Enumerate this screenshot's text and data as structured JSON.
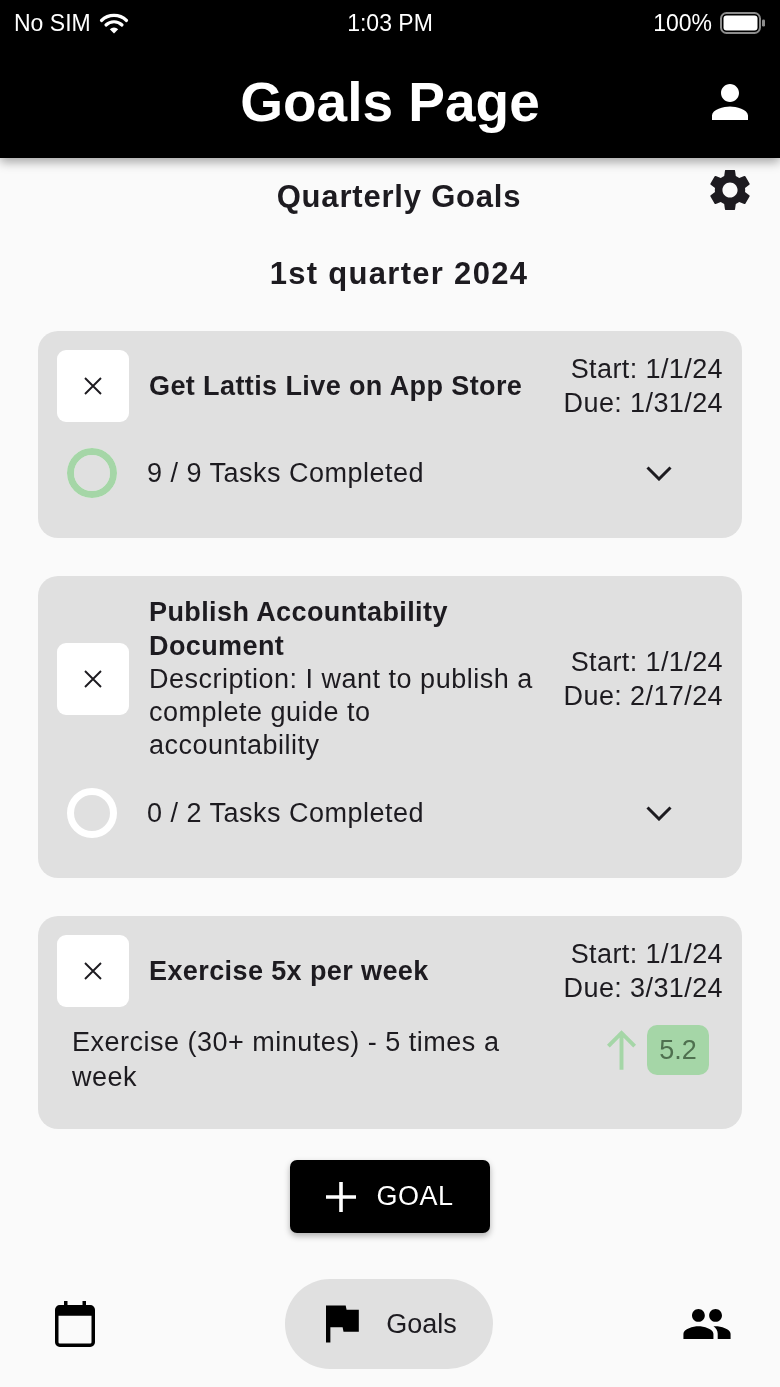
{
  "status_bar": {
    "carrier": "No SIM",
    "time": "1:03 PM",
    "battery": "100%"
  },
  "app_bar": {
    "title": "Goals Page"
  },
  "header": {
    "title": "Quarterly Goals",
    "period": "1st quarter 2024"
  },
  "goals": [
    {
      "kind": "tasks",
      "title": "Get Lattis Live on App Store",
      "start": "Start: 1/1/24",
      "due": "Due: 1/31/24",
      "progress": {
        "label": "9 / 9 Tasks Completed",
        "level": 1
      }
    },
    {
      "kind": "tasks",
      "title": "Publish Accountability Document",
      "description": "Description: I want to publish a complete guide to accountability",
      "start": "Start: 1/1/24",
      "due": "Due: 2/17/24",
      "progress": {
        "label": "0 / 2 Tasks Completed",
        "level": 0
      }
    },
    {
      "kind": "metric",
      "title": "Exercise 5x per week",
      "start": "Start: 1/1/24",
      "due": "Due: 3/31/24",
      "description": "Exercise (30+ minutes) - 5 times a week",
      "improving": true,
      "value": "5.2"
    }
  ],
  "add_button": {
    "label": "GOAL"
  },
  "bottom_nav": [
    {
      "kind": "calendar",
      "selected": false
    },
    {
      "kind": "flag",
      "label": "Goals",
      "selected": true
    },
    {
      "kind": "people",
      "selected": false
    }
  ]
}
